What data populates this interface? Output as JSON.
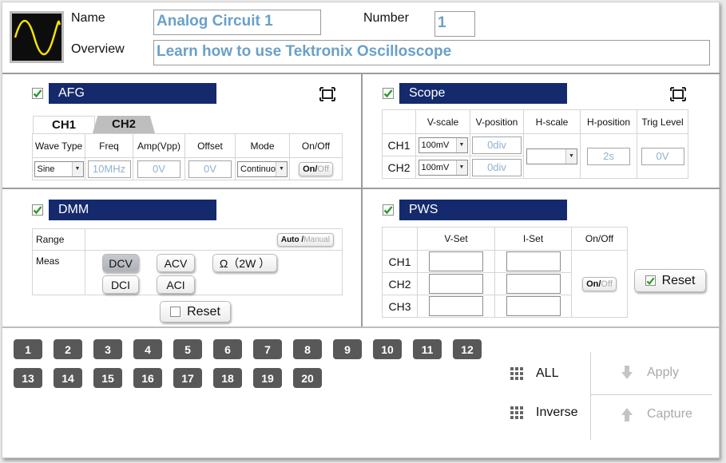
{
  "header": {
    "name_label": "Name",
    "name_value": "Analog Circuit 1",
    "number_label": "Number",
    "number_value": "1",
    "overview_label": "Overview",
    "overview_value": "Learn how to use Tektronix Oscilloscope"
  },
  "afg": {
    "title": "AFG",
    "tabs": [
      "CH1",
      "CH2"
    ],
    "headers": [
      "Wave Type",
      "Freq",
      "Amp(Vpp)",
      "Offset",
      "Mode",
      "On/Off"
    ],
    "row": {
      "wave": "Sine",
      "freq": "10MHz",
      "amp": "0V",
      "offset": "0V",
      "mode": "Continuo"
    },
    "toggle_on": "On",
    "toggle_off": "Off"
  },
  "scope": {
    "title": "Scope",
    "headers": [
      "V-scale",
      "V-position",
      "H-scale",
      "H-position",
      "Trig Level"
    ],
    "rows": [
      {
        "label": "CH1",
        "vscale": "100mV",
        "vpos": "0div"
      },
      {
        "label": "CH2",
        "vscale": "100mV",
        "vpos": "0div"
      }
    ],
    "hscale": "",
    "hpos": "2s",
    "trig": "0V"
  },
  "dmm": {
    "title": "DMM",
    "range_label": "Range",
    "auto": "Auto",
    "manual": "Manual",
    "meas_label": "Meas",
    "buttons": [
      "DCV",
      "ACV",
      "Ω（2W ）",
      "DCI",
      "ACI"
    ],
    "reset": "Reset"
  },
  "pws": {
    "title": "PWS",
    "headers": [
      "V-Set",
      "I-Set",
      "On/Off"
    ],
    "rows": [
      "CH1",
      "CH2",
      "CH3"
    ],
    "toggle_on": "On",
    "toggle_off": "Off",
    "reset": "Reset"
  },
  "numbers": [
    "1",
    "2",
    "3",
    "4",
    "5",
    "6",
    "7",
    "8",
    "9",
    "10",
    "11",
    "12",
    "13",
    "14",
    "15",
    "16",
    "17",
    "18",
    "19",
    "20"
  ],
  "actions": {
    "all": "ALL",
    "inverse": "Inverse",
    "apply": "Apply",
    "capture": "Capture"
  },
  "colors": {
    "bar": "#152a6d",
    "check": "#2d9b2d",
    "num_btn": "#585858",
    "input_text": "#6aa0c8"
  }
}
